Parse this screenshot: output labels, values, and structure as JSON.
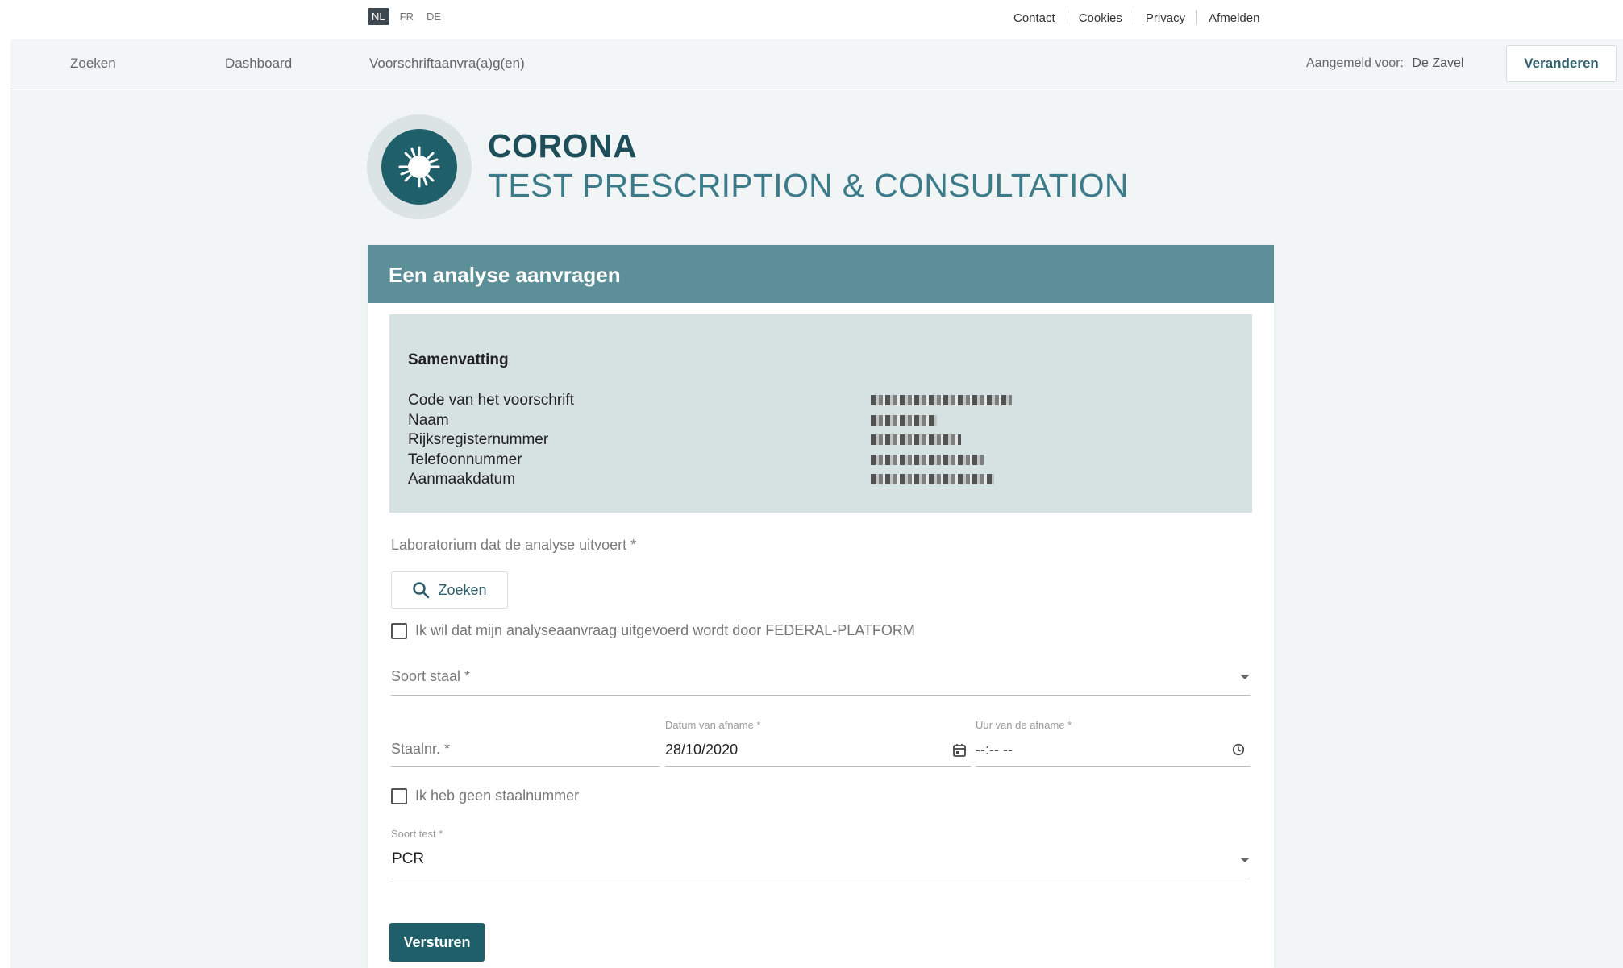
{
  "languages": [
    {
      "code": "NL",
      "active": true
    },
    {
      "code": "FR",
      "active": false
    },
    {
      "code": "DE",
      "active": false
    }
  ],
  "top_links": [
    "Contact",
    "Cookies",
    "Privacy",
    "Afmelden"
  ],
  "nav": {
    "items": [
      "Zoeken",
      "Dashboard",
      "Voorschriftaanvra(a)g(en)"
    ],
    "account_label": "Aangemeld voor:",
    "account_name": "De Zavel",
    "change_button": "Veranderen"
  },
  "hero": {
    "title": "CORONA",
    "subtitle": "TEST PRESCRIPTION & CONSULTATION"
  },
  "form": {
    "header": "Een analyse aanvragen",
    "summary": {
      "heading": "Samenvatting",
      "rows": [
        {
          "label": "Code van het voorschrift"
        },
        {
          "label": "Naam"
        },
        {
          "label": "Rijksregisternummer"
        },
        {
          "label": "Telefoonnummer"
        },
        {
          "label": "Aanmaakdatum"
        }
      ]
    },
    "lab_label": "Laboratorium dat de analyse uitvoert *",
    "search_button": "Zoeken",
    "federal_checkbox": "Ik wil dat mijn analyseaanvraag uitgevoerd wordt door FEDERAL-PLATFORM",
    "sample_type_label": "Soort staal *",
    "sample_nr_label": "Staalnr. *",
    "date_label": "Datum van afname *",
    "date_value": "28/10/2020",
    "time_label": "Uur van de afname *",
    "time_value": "--:-- --",
    "no_sample_checkbox": "Ik heb geen staalnummer",
    "test_type_label": "Soort test *",
    "test_type_value": "PCR",
    "submit_button": "Versturen"
  },
  "colors": {
    "header_teal": "#5c8f98",
    "dark_teal": "#1f5f69",
    "summary_bg": "#d6e1e2"
  }
}
